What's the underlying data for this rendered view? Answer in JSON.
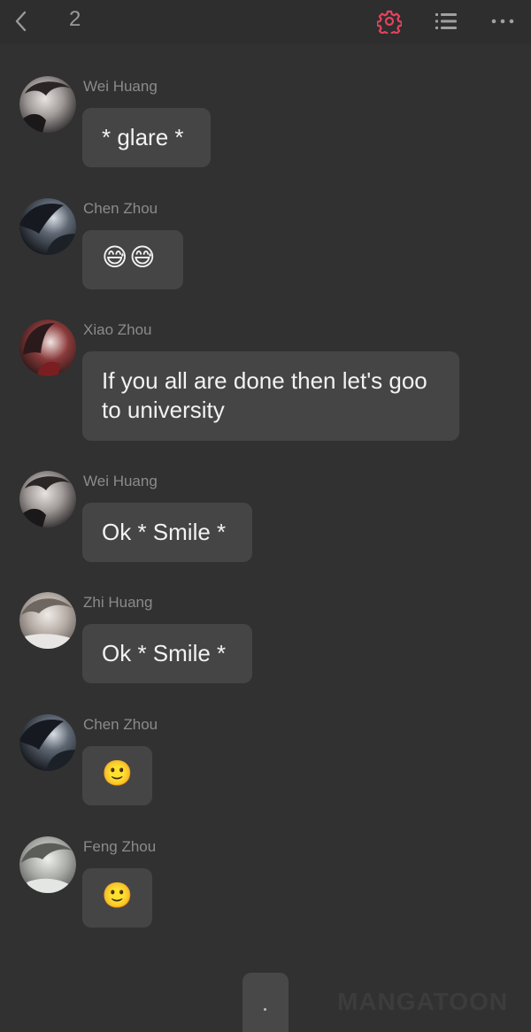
{
  "header": {
    "back_icon": "chevron-left-icon",
    "chapter": "2",
    "settings_icon": "gear-icon",
    "settings_color": "#e8425c",
    "list_icon": "list-icon",
    "more_icon": "more-horizontal-icon"
  },
  "messages": [
    {
      "sender": "Wei Huang",
      "text": "* glare *"
    },
    {
      "sender": "Chen Zhou",
      "text": "😅😅"
    },
    {
      "sender": "Xiao Zhou",
      "text": "If you all are done then let's goo to university"
    },
    {
      "sender": "Wei Huang",
      "text": "Ok * Smile *"
    },
    {
      "sender": "Zhi Huang",
      "text": "Ok * Smile *"
    },
    {
      "sender": "Chen Zhou",
      "text": "🙂"
    },
    {
      "sender": "Feng Zhou",
      "text": "🙂"
    }
  ],
  "next_button": {
    "label": "."
  },
  "watermark": "MANGATOON"
}
